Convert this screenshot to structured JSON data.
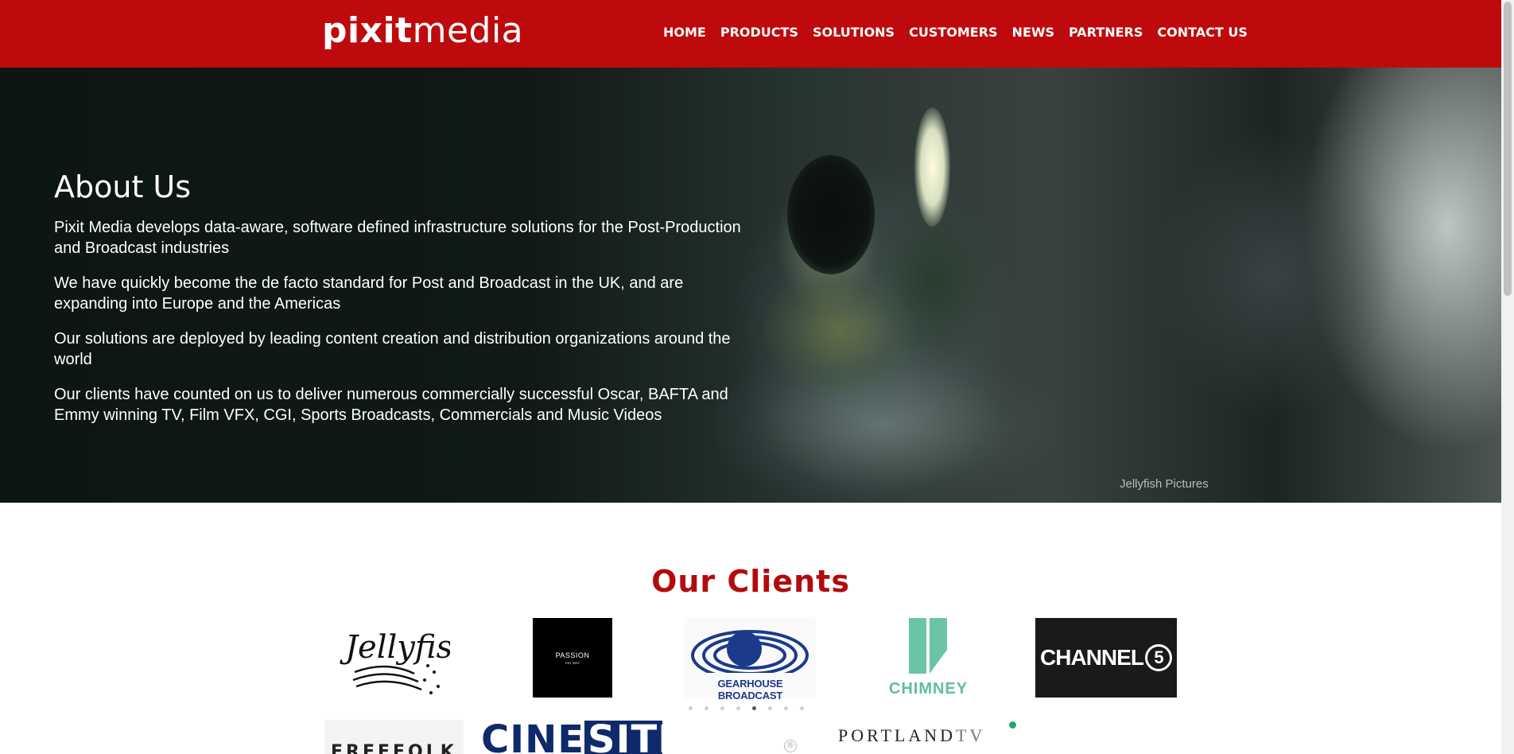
{
  "header": {
    "logo_bold": "pixit",
    "logo_light": "media",
    "nav": [
      "HOME",
      "PRODUCTS",
      "SOLUTIONS",
      "CUSTOMERS",
      "NEWS",
      "PARTNERS",
      "CONTACT US"
    ],
    "background_color": "#bf0a0d"
  },
  "hero": {
    "title": "About Us",
    "paragraphs": [
      "Pixit Media develops data-aware, software defined infrastructure solutions for the Post-Production and Broadcast industries",
      "We have quickly become the de facto standard for Post and Broadcast in the UK, and are expanding into Europe and the Americas",
      "Our solutions are deployed by leading content creation and distribution organizations around the world",
      "Our clients have counted on us to deliver numerous commercially successful Oscar, BAFTA and Emmy winning TV, Film VFX, CGI, Sports Broadcasts, Commercials and Music Videos"
    ],
    "image_credit": "Jellyfish Pictures"
  },
  "clients": {
    "title": "Our Clients",
    "title_color": "#b30b0d",
    "logos": {
      "passion": {
        "title": "PASSION",
        "sub": "EST 2007"
      },
      "gearhouse": "GEARHOUSE BROADCAST",
      "chimney": "CHIMNEY",
      "channel5_word": "CHANNEL",
      "channel5_num": "5",
      "row2_a": "FREEFOLK",
      "cinesite_a": "CINE",
      "cinesite_b": "SITE",
      "portland_a": "PORTLAND",
      "portland_b": "TV"
    },
    "carousel": {
      "dot_count": 8,
      "active_index": 4
    }
  }
}
